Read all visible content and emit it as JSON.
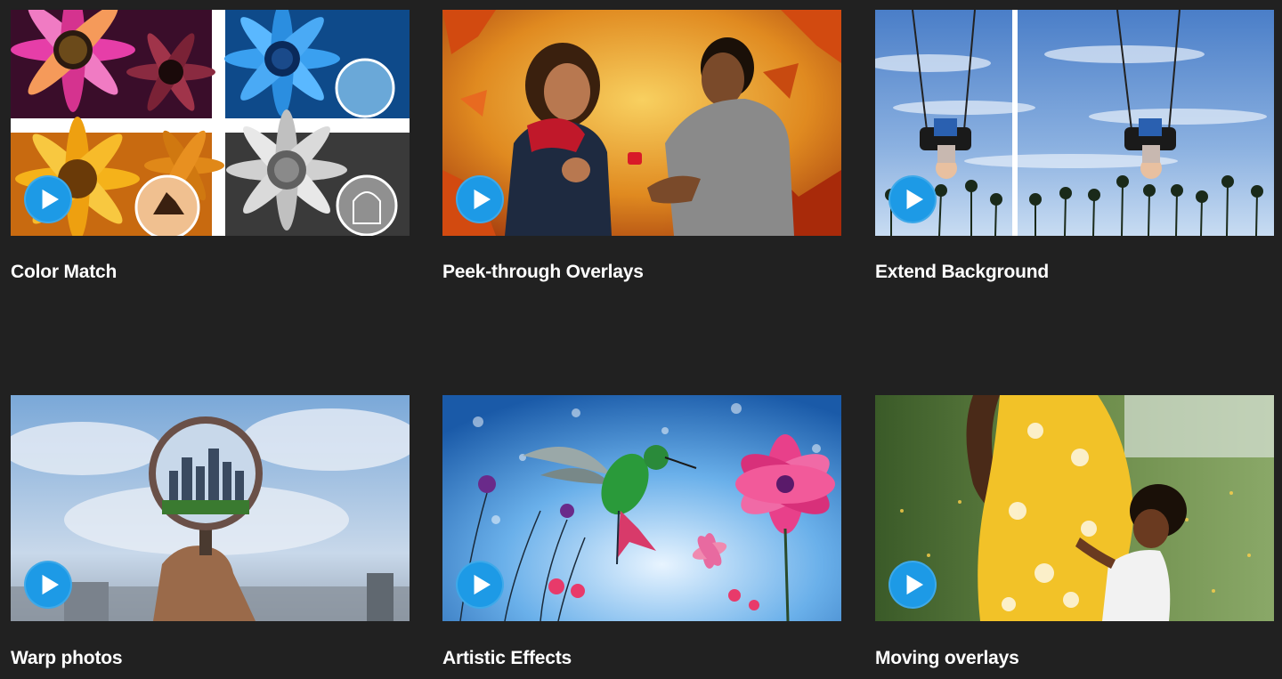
{
  "videos": [
    {
      "title": "Color Match",
      "play_icon": "play-icon"
    },
    {
      "title": "Peek-through Overlays",
      "play_icon": "play-icon"
    },
    {
      "title": "Extend Background",
      "play_icon": "play-icon"
    },
    {
      "title": "Warp photos",
      "play_icon": "play-icon"
    },
    {
      "title": "Artistic Effects",
      "play_icon": "play-icon"
    },
    {
      "title": "Moving overlays",
      "play_icon": "play-icon"
    }
  ],
  "colors": {
    "background": "#212121",
    "play_button": "#1d9ae6",
    "title_text": "#ffffff"
  }
}
